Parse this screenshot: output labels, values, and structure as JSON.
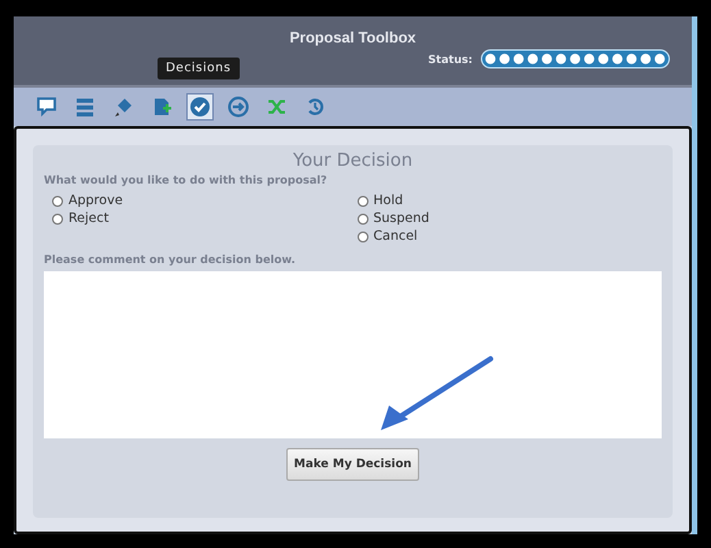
{
  "window": {
    "title": "Proposal Toolbox"
  },
  "status": {
    "label": "Status:"
  },
  "toolbar": [
    {
      "kind": "comment",
      "selected": false
    },
    {
      "kind": "list",
      "selected": false
    },
    {
      "kind": "pen",
      "selected": false
    },
    {
      "kind": "add",
      "selected": false
    },
    {
      "kind": "check",
      "selected": true
    },
    {
      "kind": "arrow",
      "selected": false
    },
    {
      "kind": "shuffle",
      "selected": false
    },
    {
      "kind": "history",
      "selected": false
    }
  ],
  "tooltip": "Decisions",
  "panel": {
    "title": "Your Decision",
    "question": "What would you like to do with this proposal?",
    "options_left": [
      {
        "label": "Approve",
        "selected": false
      },
      {
        "label": "Reject",
        "selected": false
      }
    ],
    "options_right": [
      {
        "label": "Hold",
        "selected": false
      },
      {
        "label": "Suspend",
        "selected": false
      },
      {
        "label": "Cancel",
        "selected": false
      }
    ],
    "comment_label": "Please comment on your decision below.",
    "submit": "Make My Decision"
  }
}
